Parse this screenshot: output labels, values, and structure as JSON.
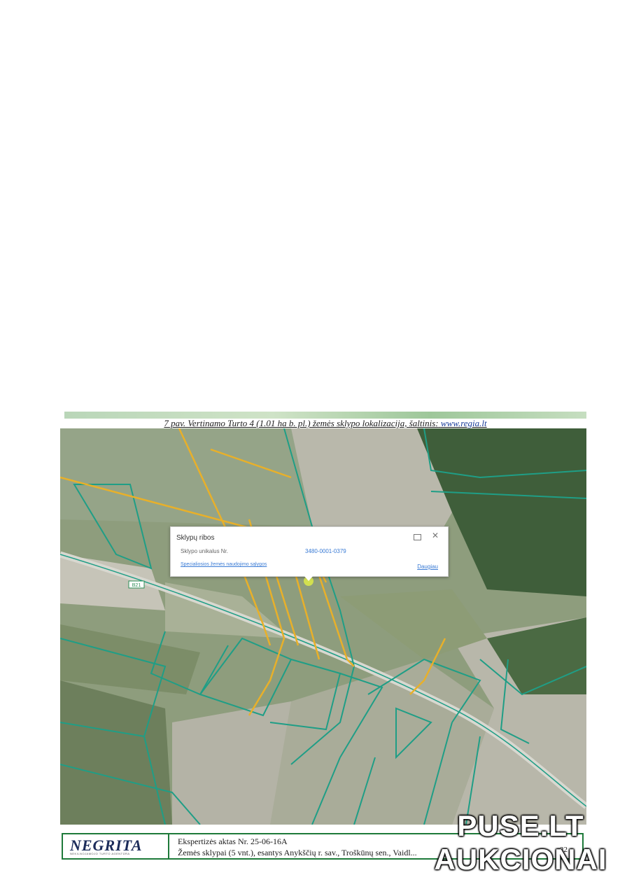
{
  "caption": {
    "text": "7 pav. Vertinamo Turto 4 (1.01 ha b. pl.) žemės sklypo lokalizacija, šaltinis:",
    "link": "www.regia.lt"
  },
  "map": {
    "road_label": "B21",
    "popup": {
      "title": "Sklypų ribos",
      "label": "Sklypo unikalus Nr.",
      "value": "3480-0001-0379",
      "link": "Specialiosios žemės naudojimo sąlygos",
      "more": "Daugiau"
    }
  },
  "footer": {
    "logo": "NEGRITA",
    "logo_sub": "NEKILNOJAMOJO TURTO AGENTŪRA",
    "line1": "Ekspertizės aktas Nr. 25-06-16A",
    "line2": "Žemės sklypai (5 vnt.), esantys Anykščių r. sav., Troškūnų sen., Vaidl...",
    "page_number": "22"
  },
  "watermark": {
    "line1": "PUSE.LT",
    "line2": "AUKCIONAI"
  },
  "colors": {
    "parcel_border": "#1f9e86",
    "highlight_parcel": "#e8b02a",
    "footer_border": "#1e7a3a",
    "link": "#3a7bd5"
  }
}
